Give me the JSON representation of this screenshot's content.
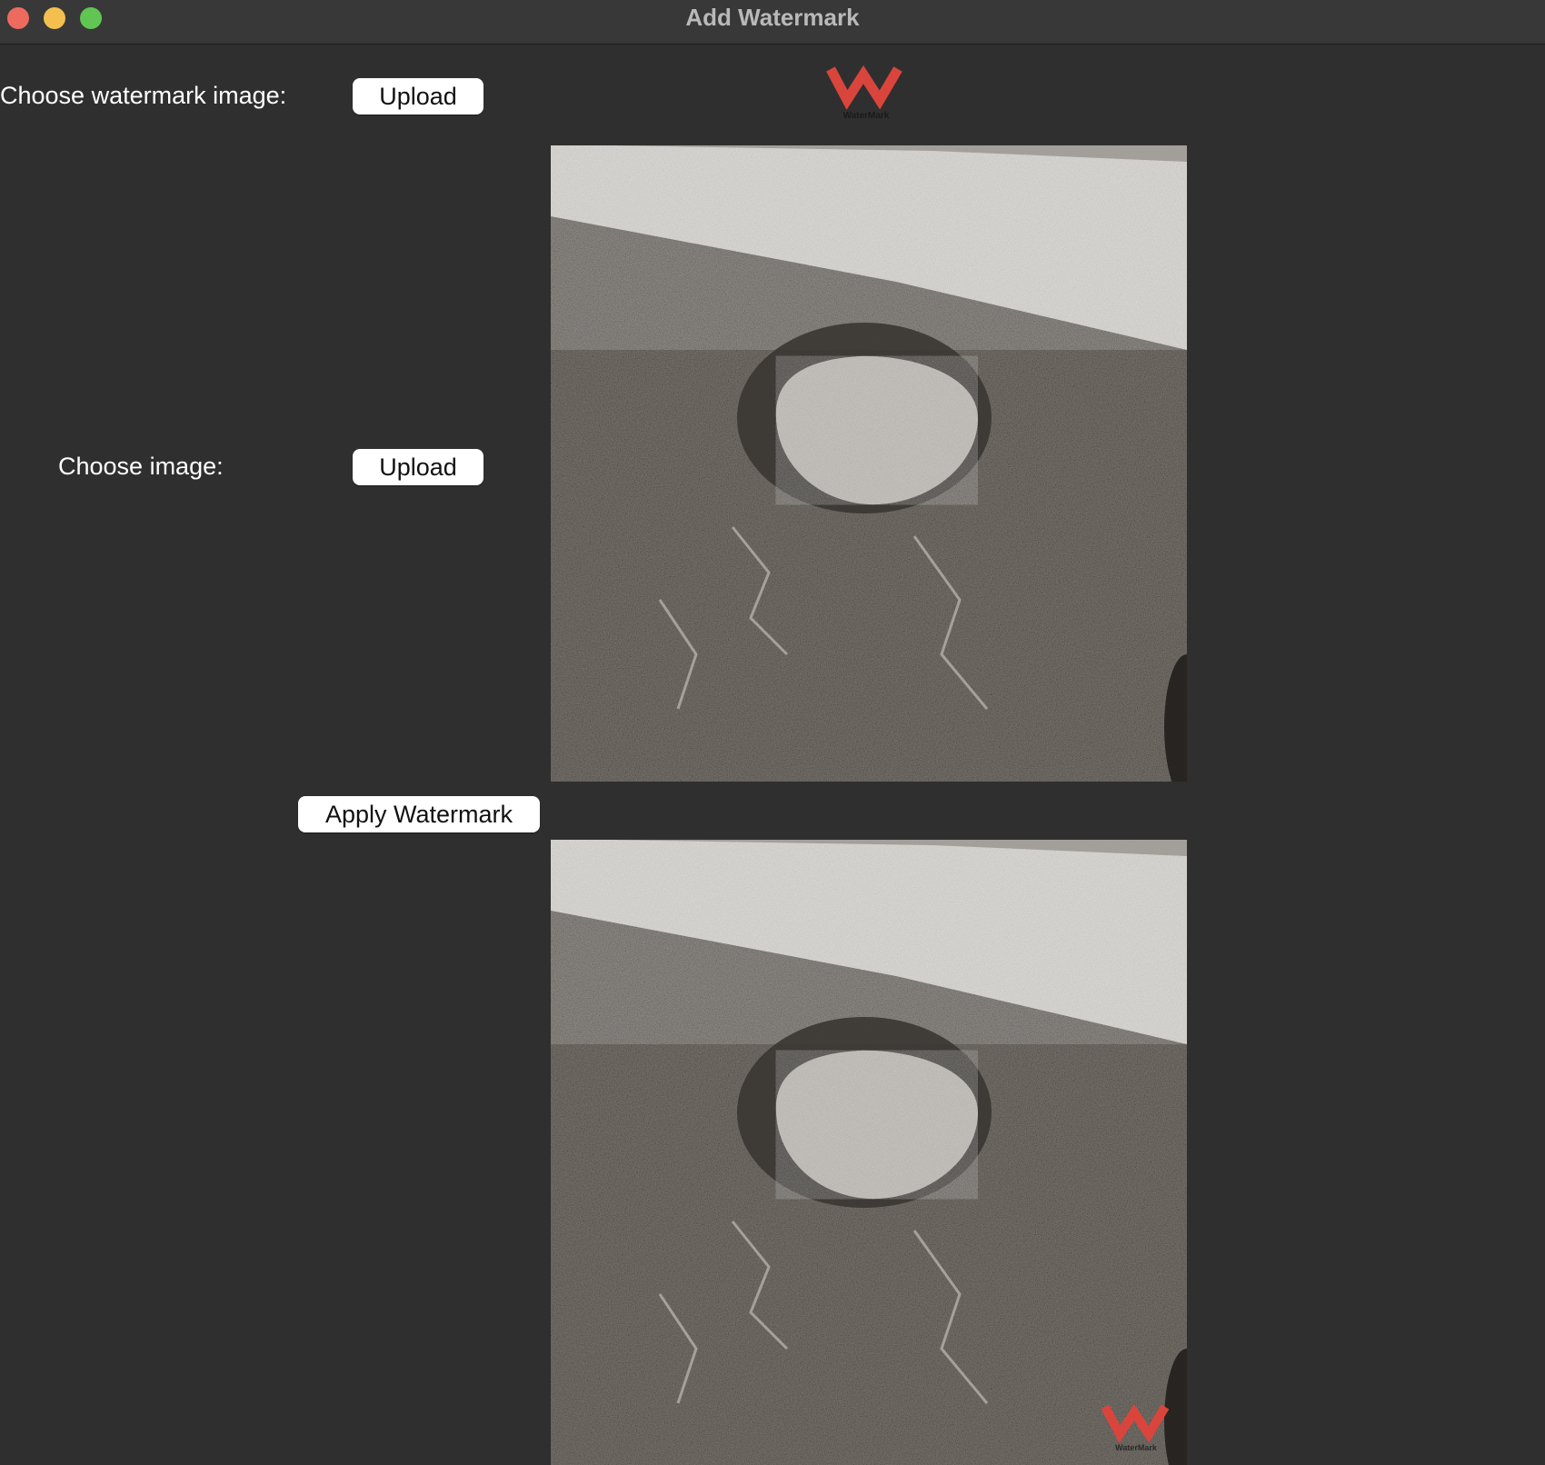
{
  "window": {
    "title": "Add Watermark"
  },
  "form": {
    "watermark_label": "Choose watermark image:",
    "watermark_upload_label": "Upload",
    "image_label": "Choose image:",
    "image_upload_label": "Upload",
    "apply_label": "Apply Watermark"
  },
  "watermark_logo": {
    "caption": "WaterMark",
    "color": "#d9453c"
  },
  "colors": {
    "background": "#2f2f2f",
    "button": "#ffffff"
  }
}
